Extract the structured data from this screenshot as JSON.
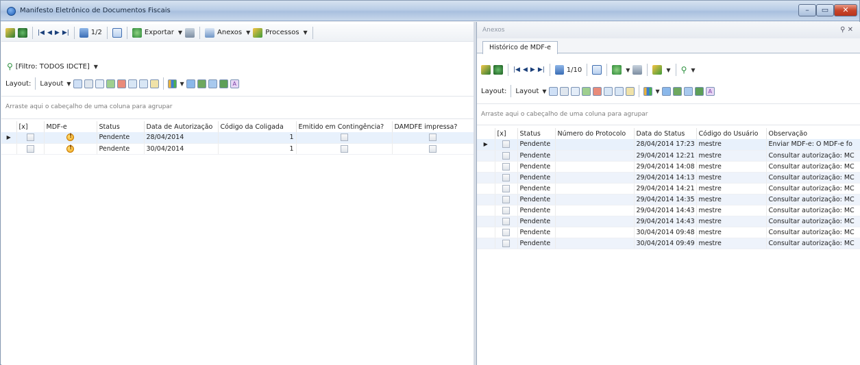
{
  "window": {
    "title": "Manifesto Eletrônico de Documentos Fiscais"
  },
  "left": {
    "toolbar": {
      "page_indicator": "1/2",
      "export_label": "Exportar",
      "attachments_label": "Anexos",
      "processes_label": "Processos"
    },
    "filter_label": "[Filtro: TODOS IDCTE]",
    "layout_label": "Layout:",
    "layout_dropdown": "Layout",
    "group_hint": "Arraste aqui o cabeçalho de uma coluna para agrupar",
    "columns": [
      "[x]",
      "MDF-e",
      "Status",
      "Data de Autorização",
      "Código da Coligada",
      "Emitido em Contingência?",
      "DAMDFE impressa?"
    ],
    "rows": [
      {
        "status": "Pendente",
        "date": "28/04/2014",
        "coligada": "1"
      },
      {
        "status": "Pendente",
        "date": "30/04/2014",
        "coligada": "1"
      }
    ]
  },
  "right": {
    "panel_title": "Anexos",
    "panel_buttons": "⚲ ✕",
    "tab_label": "Histórico de MDF-e",
    "toolbar": {
      "page_indicator": "1/10"
    },
    "layout_label": "Layout:",
    "layout_dropdown": "Layout",
    "group_hint": "Arraste aqui o cabeçalho de uma coluna para agrupar",
    "columns": [
      "[x]",
      "Status",
      "Número do Protocolo",
      "Data do Status",
      "Código do Usuário",
      "Observação"
    ],
    "rows": [
      {
        "status": "Pendente",
        "protocol": "",
        "date": "28/04/2014 17:23",
        "user": "mestre",
        "obs": "Enviar MDF-e: O MDF-e fo"
      },
      {
        "status": "Pendente",
        "protocol": "",
        "date": "29/04/2014 12:21",
        "user": "mestre",
        "obs": "Consultar autorização: MC"
      },
      {
        "status": "Pendente",
        "protocol": "",
        "date": "29/04/2014 14:08",
        "user": "mestre",
        "obs": "Consultar autorização: MC"
      },
      {
        "status": "Pendente",
        "protocol": "",
        "date": "29/04/2014 14:13",
        "user": "mestre",
        "obs": "Consultar autorização: MC"
      },
      {
        "status": "Pendente",
        "protocol": "",
        "date": "29/04/2014 14:21",
        "user": "mestre",
        "obs": "Consultar autorização: MC"
      },
      {
        "status": "Pendente",
        "protocol": "",
        "date": "29/04/2014 14:35",
        "user": "mestre",
        "obs": "Consultar autorização: MC"
      },
      {
        "status": "Pendente",
        "protocol": "",
        "date": "29/04/2014 14:43",
        "user": "mestre",
        "obs": "Consultar autorização: MC"
      },
      {
        "status": "Pendente",
        "protocol": "",
        "date": "29/04/2014 14:43",
        "user": "mestre",
        "obs": "Consultar autorização: MC"
      },
      {
        "status": "Pendente",
        "protocol": "",
        "date": "30/04/2014 09:48",
        "user": "mestre",
        "obs": "Consultar autorização: MC"
      },
      {
        "status": "Pendente",
        "protocol": "",
        "date": "30/04/2014 09:49",
        "user": "mestre",
        "obs": "Consultar autorização: MC"
      }
    ]
  },
  "colors": {
    "title_gradient": "#b9cde6",
    "selection": "#e8f1fc",
    "alt_row": "#eef3fb"
  }
}
